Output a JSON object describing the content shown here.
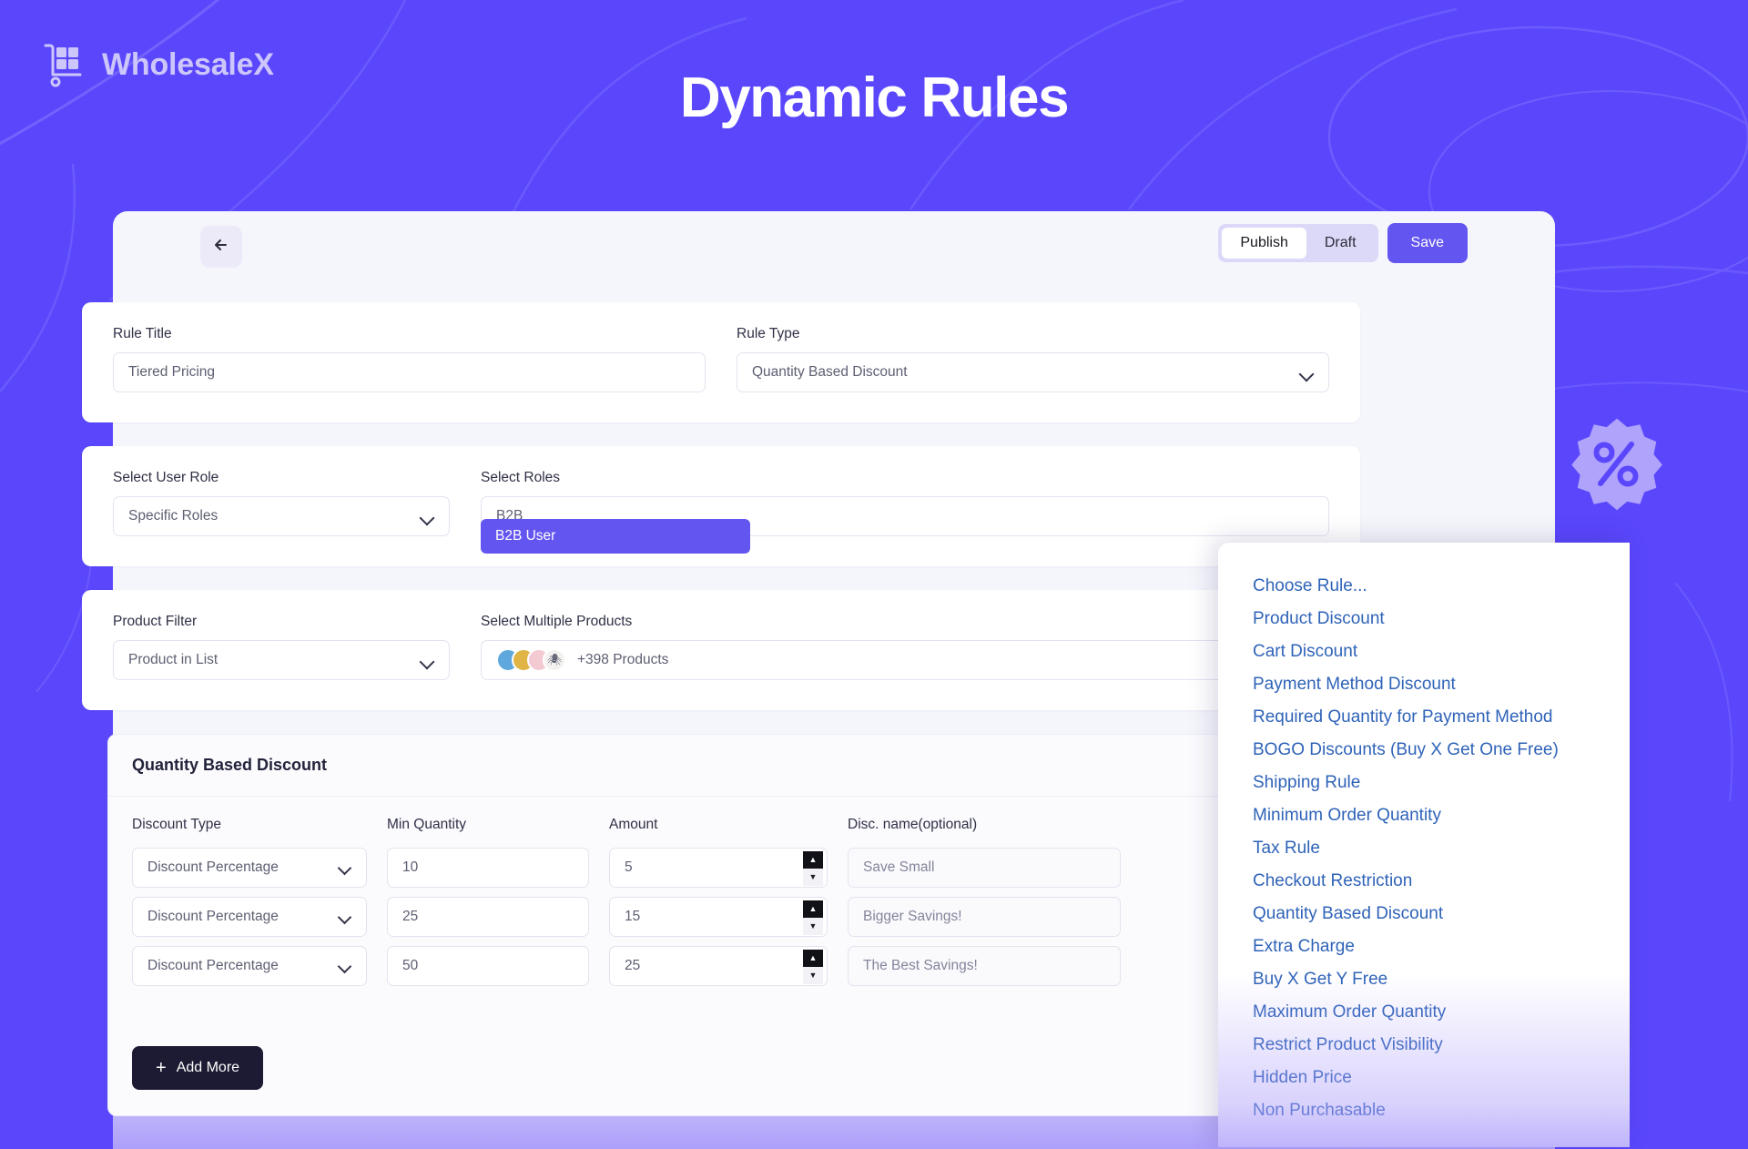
{
  "theme": {
    "background": "#5a47fc",
    "accent": "#6355f0",
    "card_bg": "#f5f6fc",
    "dark_button": "#1c1b33",
    "menu_link": "#2f63b8"
  },
  "brand": {
    "name": "WholesaleX",
    "logo_icon": "cart-trolley-icon"
  },
  "page": {
    "title": "Dynamic Rules",
    "decoration_icon": "percent-badge-icon"
  },
  "toolbar": {
    "back_icon": "arrow-left-icon",
    "status_options": [
      {
        "label": "Publish",
        "active": true
      },
      {
        "label": "Draft",
        "active": false
      }
    ],
    "save_label": "Save"
  },
  "form": {
    "rule_title": {
      "label": "Rule Title",
      "value": "Tiered Pricing",
      "placeholder": "Tiered Pricing"
    },
    "rule_type": {
      "label": "Rule Type",
      "value": "Quantity Based Discount",
      "chevron_icon": "chevron-down-icon"
    },
    "user_role": {
      "label": "Select User Role",
      "value": "Specific Roles",
      "chevron_icon": "chevron-down-icon"
    },
    "roles": {
      "label": "Select Roles",
      "value": "B2B",
      "highlighted_option": "B2B User"
    },
    "product_filter": {
      "label": "Product Filter",
      "value": "Product in List",
      "chevron_icon": "chevron-down-icon"
    },
    "products": {
      "label": "Select Multiple Products",
      "count_label": "+398 Products",
      "thumbnails": [
        "product-thumb-1",
        "product-thumb-2",
        "product-thumb-3",
        "product-thumb-4"
      ]
    }
  },
  "discount_table": {
    "title": "Quantity Based Discount",
    "headers": [
      "Discount Type",
      "Min Quantity",
      "Amount",
      "Disc. name(optional)"
    ],
    "rows": [
      {
        "type": "Discount Percentage",
        "min_qty": "10",
        "amount": "5",
        "name": "Save Small"
      },
      {
        "type": "Discount Percentage",
        "min_qty": "25",
        "amount": "15",
        "name": "Bigger Savings!"
      },
      {
        "type": "Discount Percentage",
        "min_qty": "50",
        "amount": "25",
        "name": "The Best Savings!"
      }
    ],
    "add_more_label": "Add More",
    "add_more_icon": "plus-icon",
    "spinner_up_icon": "caret-up-icon",
    "spinner_down_icon": "caret-down-icon"
  },
  "rule_menu": {
    "items": [
      "Choose Rule...",
      "Product Discount",
      "Cart Discount",
      "Payment Method Discount",
      "Required Quantity for Payment Method",
      "BOGO Discounts (Buy X Get One Free)",
      "Shipping Rule",
      "Minimum Order Quantity",
      "Tax Rule",
      "Checkout Restriction",
      "Quantity Based Discount",
      "Extra Charge",
      "Buy X Get Y Free",
      "Maximum Order Quantity",
      "Restrict Product Visibility",
      "Hidden Price",
      "Non Purchasable"
    ]
  }
}
